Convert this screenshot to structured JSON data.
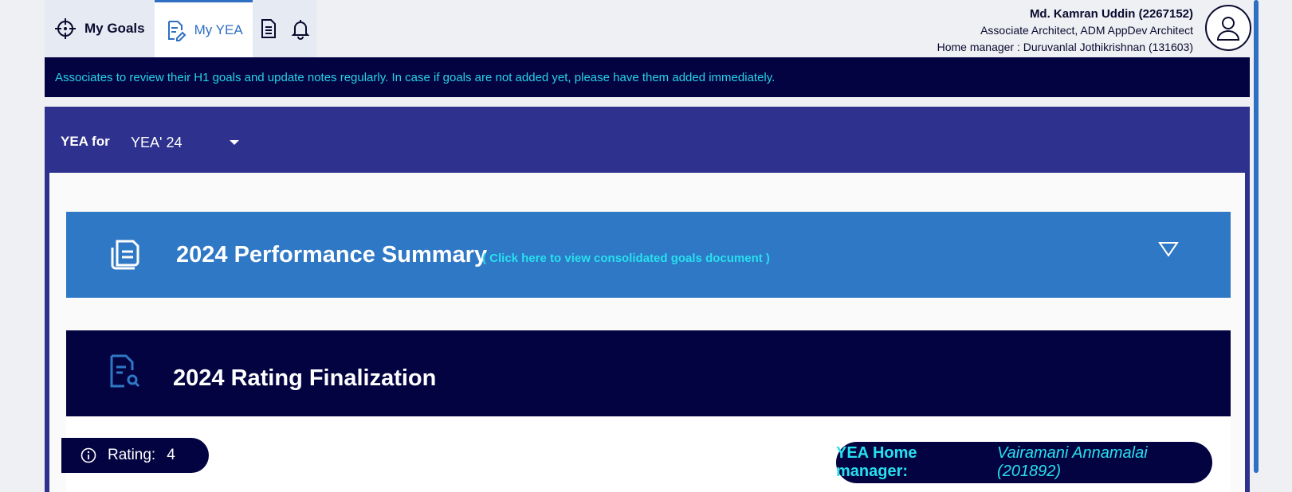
{
  "nav": {
    "tabs": [
      {
        "label": "My Goals",
        "icon": "crosshair-icon"
      },
      {
        "label": "My YEA",
        "icon": "document-edit-icon"
      },
      {
        "label": "",
        "icon": "document-icon"
      },
      {
        "label": "",
        "icon": "bell-icon"
      }
    ]
  },
  "user": {
    "name": "Md. Kamran Uddin (2267152)",
    "role": "Associate Architect, ADM AppDev Architect",
    "manager": "Home manager : Duruvanlal Jothikrishnan (131603)"
  },
  "banner": {
    "text": "Associates to review their H1 goals and update notes regularly. In case if goals are not added yet, please have them added immediately."
  },
  "yea": {
    "label": "YEA for",
    "selected": "YEA' 24"
  },
  "summary": {
    "title": "2024 Performance Summary",
    "link": "( Click here to view consolidated goals document )"
  },
  "rating_section": {
    "title": "2024 Rating Finalization"
  },
  "rating_pill": {
    "label": "Rating:",
    "value": "4"
  },
  "manager_pill": {
    "label": "YEA Home manager:",
    "value": "Vairamani Annamalai (201892)"
  },
  "colors": {
    "accent": "#2f6fc2",
    "banner_bg": "#030342",
    "banner_text": "#27d3e5",
    "yea_bar": "#2e318e",
    "summary_bg": "#2f78c6"
  }
}
